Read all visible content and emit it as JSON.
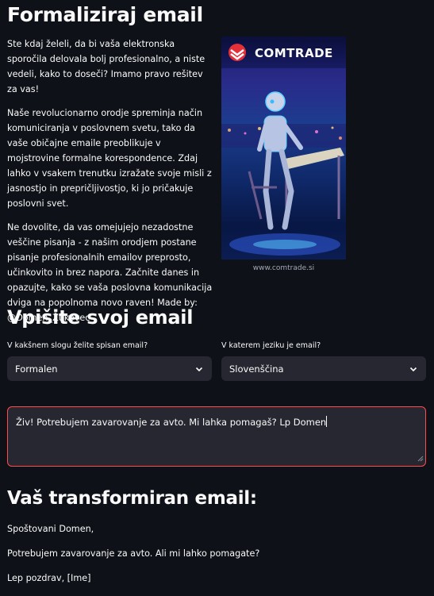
{
  "page": {
    "title": "Formaliziraj email",
    "intro_paragraphs": [
      "Ste kdaj želeli, da bi vaša elektronska sporočila delovala bolj profesionalno, a niste vedeli, kako to doseči? Imamo pravo rešitev za vas!",
      "Naše revolucionarno orodje spreminja način komuniciranja v poslovnem svetu, tako da vaše običajne emaile preoblikuje v mojstrovine formalne korespondence. Zdaj lahko v vsakem trenutku izražate svoje misli z jasnostjo in prepričljivostjo, ki jo pričakuje poslovni svet.",
      "Ne dovolite, da vas omejujejo nezadostne veščine pisanja - z našim orodjem postane pisanje profesionalnih emailov preprosto, učinkovito in brez napora. Začnite danes in opazujte, kako se vaša poslovna komunikacija dviga na popolnoma novo raven! Made by: @Domen_Žukovec"
    ]
  },
  "hero": {
    "logo_text": "COMTRADE",
    "caption": "www.comtrade.si"
  },
  "input_section": {
    "heading": "Vpišite svoj email",
    "style_label": "V kakšnem slogu želite spisan email?",
    "style_value": "Formalen",
    "language_label": "V katerem jeziku je email?",
    "language_value": "Slovenščina",
    "email_text": "Živ! Potrebujem zavarovanje za avto. Mi lahka pomagaš? Lp Domen"
  },
  "output_section": {
    "heading": "Vaš transformiran email:",
    "lines": [
      "Spoštovani Domen,",
      "Potrebujem zavarovanje za avto. Ali mi lahko pomagate?",
      "Lep pozdrav, [Ime]"
    ]
  },
  "colors": {
    "background": "#0e1117",
    "input_bg": "#262730",
    "focus_border": "#ff4b4b",
    "logo_red": "#e5303a"
  },
  "icons": {
    "select_chevron": "chevron-down-icon",
    "resize": "resize-handle-icon"
  }
}
